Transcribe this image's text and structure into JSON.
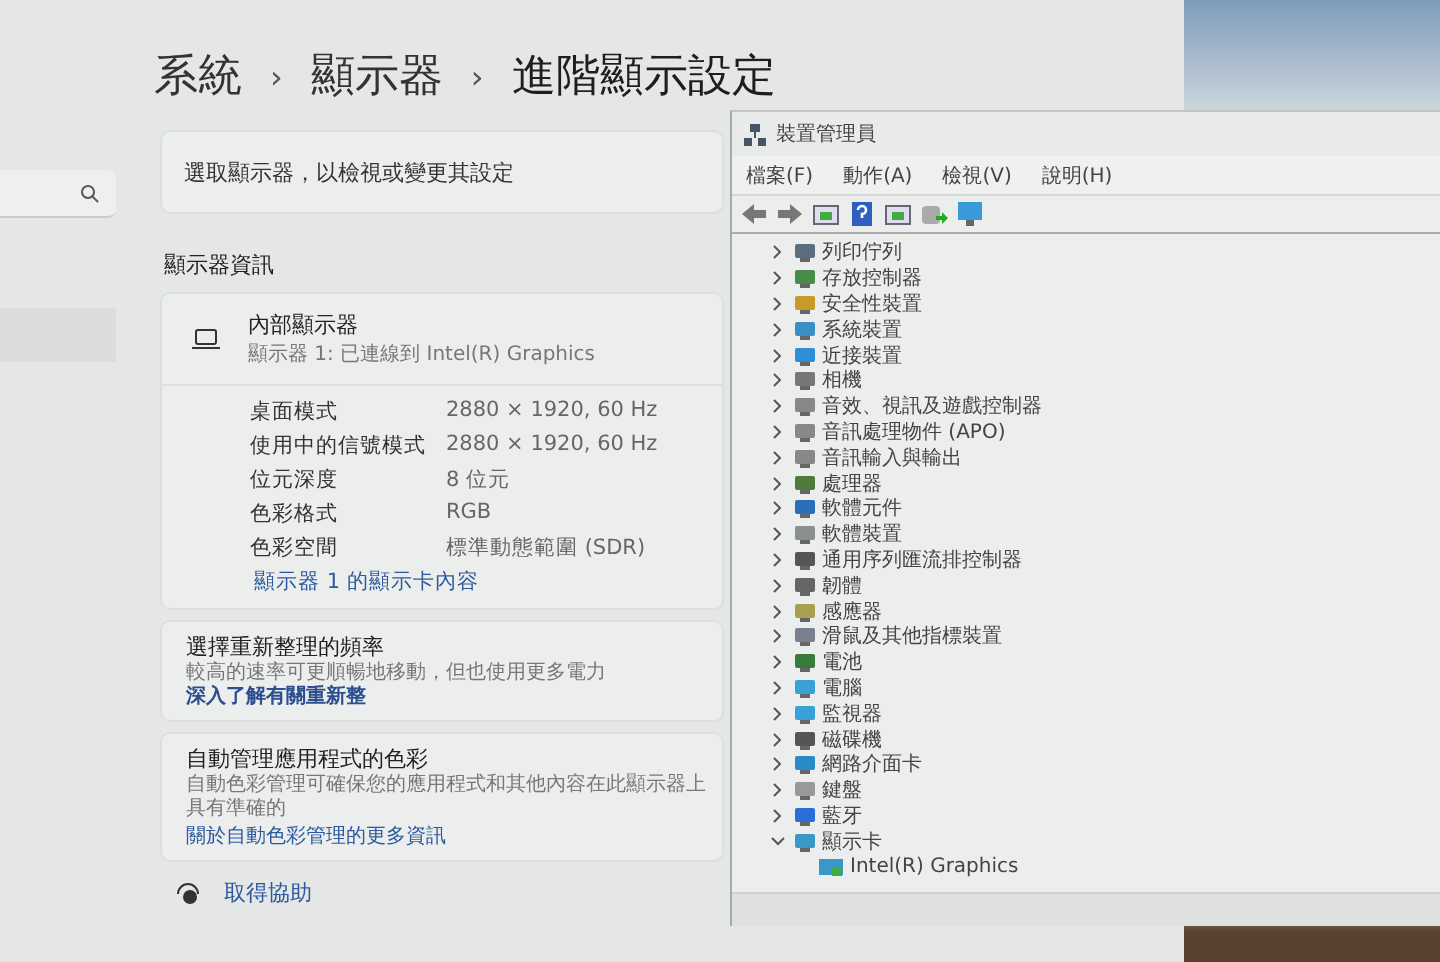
{
  "settings": {
    "breadcrumb": [
      "系統",
      "顯示器",
      "進階顯示設定"
    ],
    "separator": "›",
    "select_display": "選取顯示器，以檢視或變更其設定",
    "section_heading": "顯示器資訊",
    "display": {
      "name": "內部顯示器",
      "subtitle": "顯示器 1: 已連線到 Intel(R) Graphics"
    },
    "specs": [
      {
        "label": "桌面模式",
        "value": "2880 × 1920, 60 Hz"
      },
      {
        "label": "使用中的信號模式",
        "value": "2880 × 1920, 60 Hz"
      },
      {
        "label": "位元深度",
        "value": "8 位元"
      },
      {
        "label": "色彩格式",
        "value": "RGB"
      },
      {
        "label": "色彩空間",
        "value": "標準動態範圍 (SDR)"
      }
    ],
    "adapter_link": "顯示器 1 的顯示卡內容",
    "cards": [
      {
        "title": "選擇重新整理的頻率",
        "description": "較高的速率可更順暢地移動，但也使用更多電力",
        "link": "深入了解有關重新整"
      },
      {
        "title": "自動管理應用程式的色彩",
        "description": "自動色彩管理可確保您的應用程式和其他內容在此顯示器上具有準確的",
        "link": "關於自動色彩管理的更多資訊"
      }
    ],
    "help_link": "取得協助"
  },
  "device_manager": {
    "title": "裝置管理員",
    "menu": [
      "檔案(F)",
      "動作(A)",
      "檢視(V)",
      "說明(H)"
    ],
    "tree": [
      {
        "label": "列印佇列",
        "expanded": false
      },
      {
        "label": "存放控制器",
        "expanded": false
      },
      {
        "label": "安全性裝置",
        "expanded": false
      },
      {
        "label": "系統裝置",
        "expanded": false
      },
      {
        "label": "近接裝置",
        "expanded": false
      },
      {
        "label": "相機",
        "expanded": false
      },
      {
        "label": "音效、視訊及遊戲控制器",
        "expanded": false
      },
      {
        "label": "音訊處理物件 (APO)",
        "expanded": false
      },
      {
        "label": "音訊輸入與輸出",
        "expanded": false
      },
      {
        "label": "處理器",
        "expanded": false
      },
      {
        "label": "軟體元件",
        "expanded": false
      },
      {
        "label": "軟體裝置",
        "expanded": false
      },
      {
        "label": "通用序列匯流排控制器",
        "expanded": false
      },
      {
        "label": "韌體",
        "expanded": false
      },
      {
        "label": "感應器",
        "expanded": false
      },
      {
        "label": "滑鼠及其他指標裝置",
        "expanded": false
      },
      {
        "label": "電池",
        "expanded": false
      },
      {
        "label": "電腦",
        "expanded": false
      },
      {
        "label": "監視器",
        "expanded": false
      },
      {
        "label": "磁碟機",
        "expanded": false
      },
      {
        "label": "網路介面卡",
        "expanded": false
      },
      {
        "label": "鍵盤",
        "expanded": false
      },
      {
        "label": "藍牙",
        "expanded": false
      },
      {
        "label": "顯示卡",
        "expanded": true,
        "children": [
          {
            "label": "Intel(R) Graphics"
          }
        ]
      }
    ]
  }
}
